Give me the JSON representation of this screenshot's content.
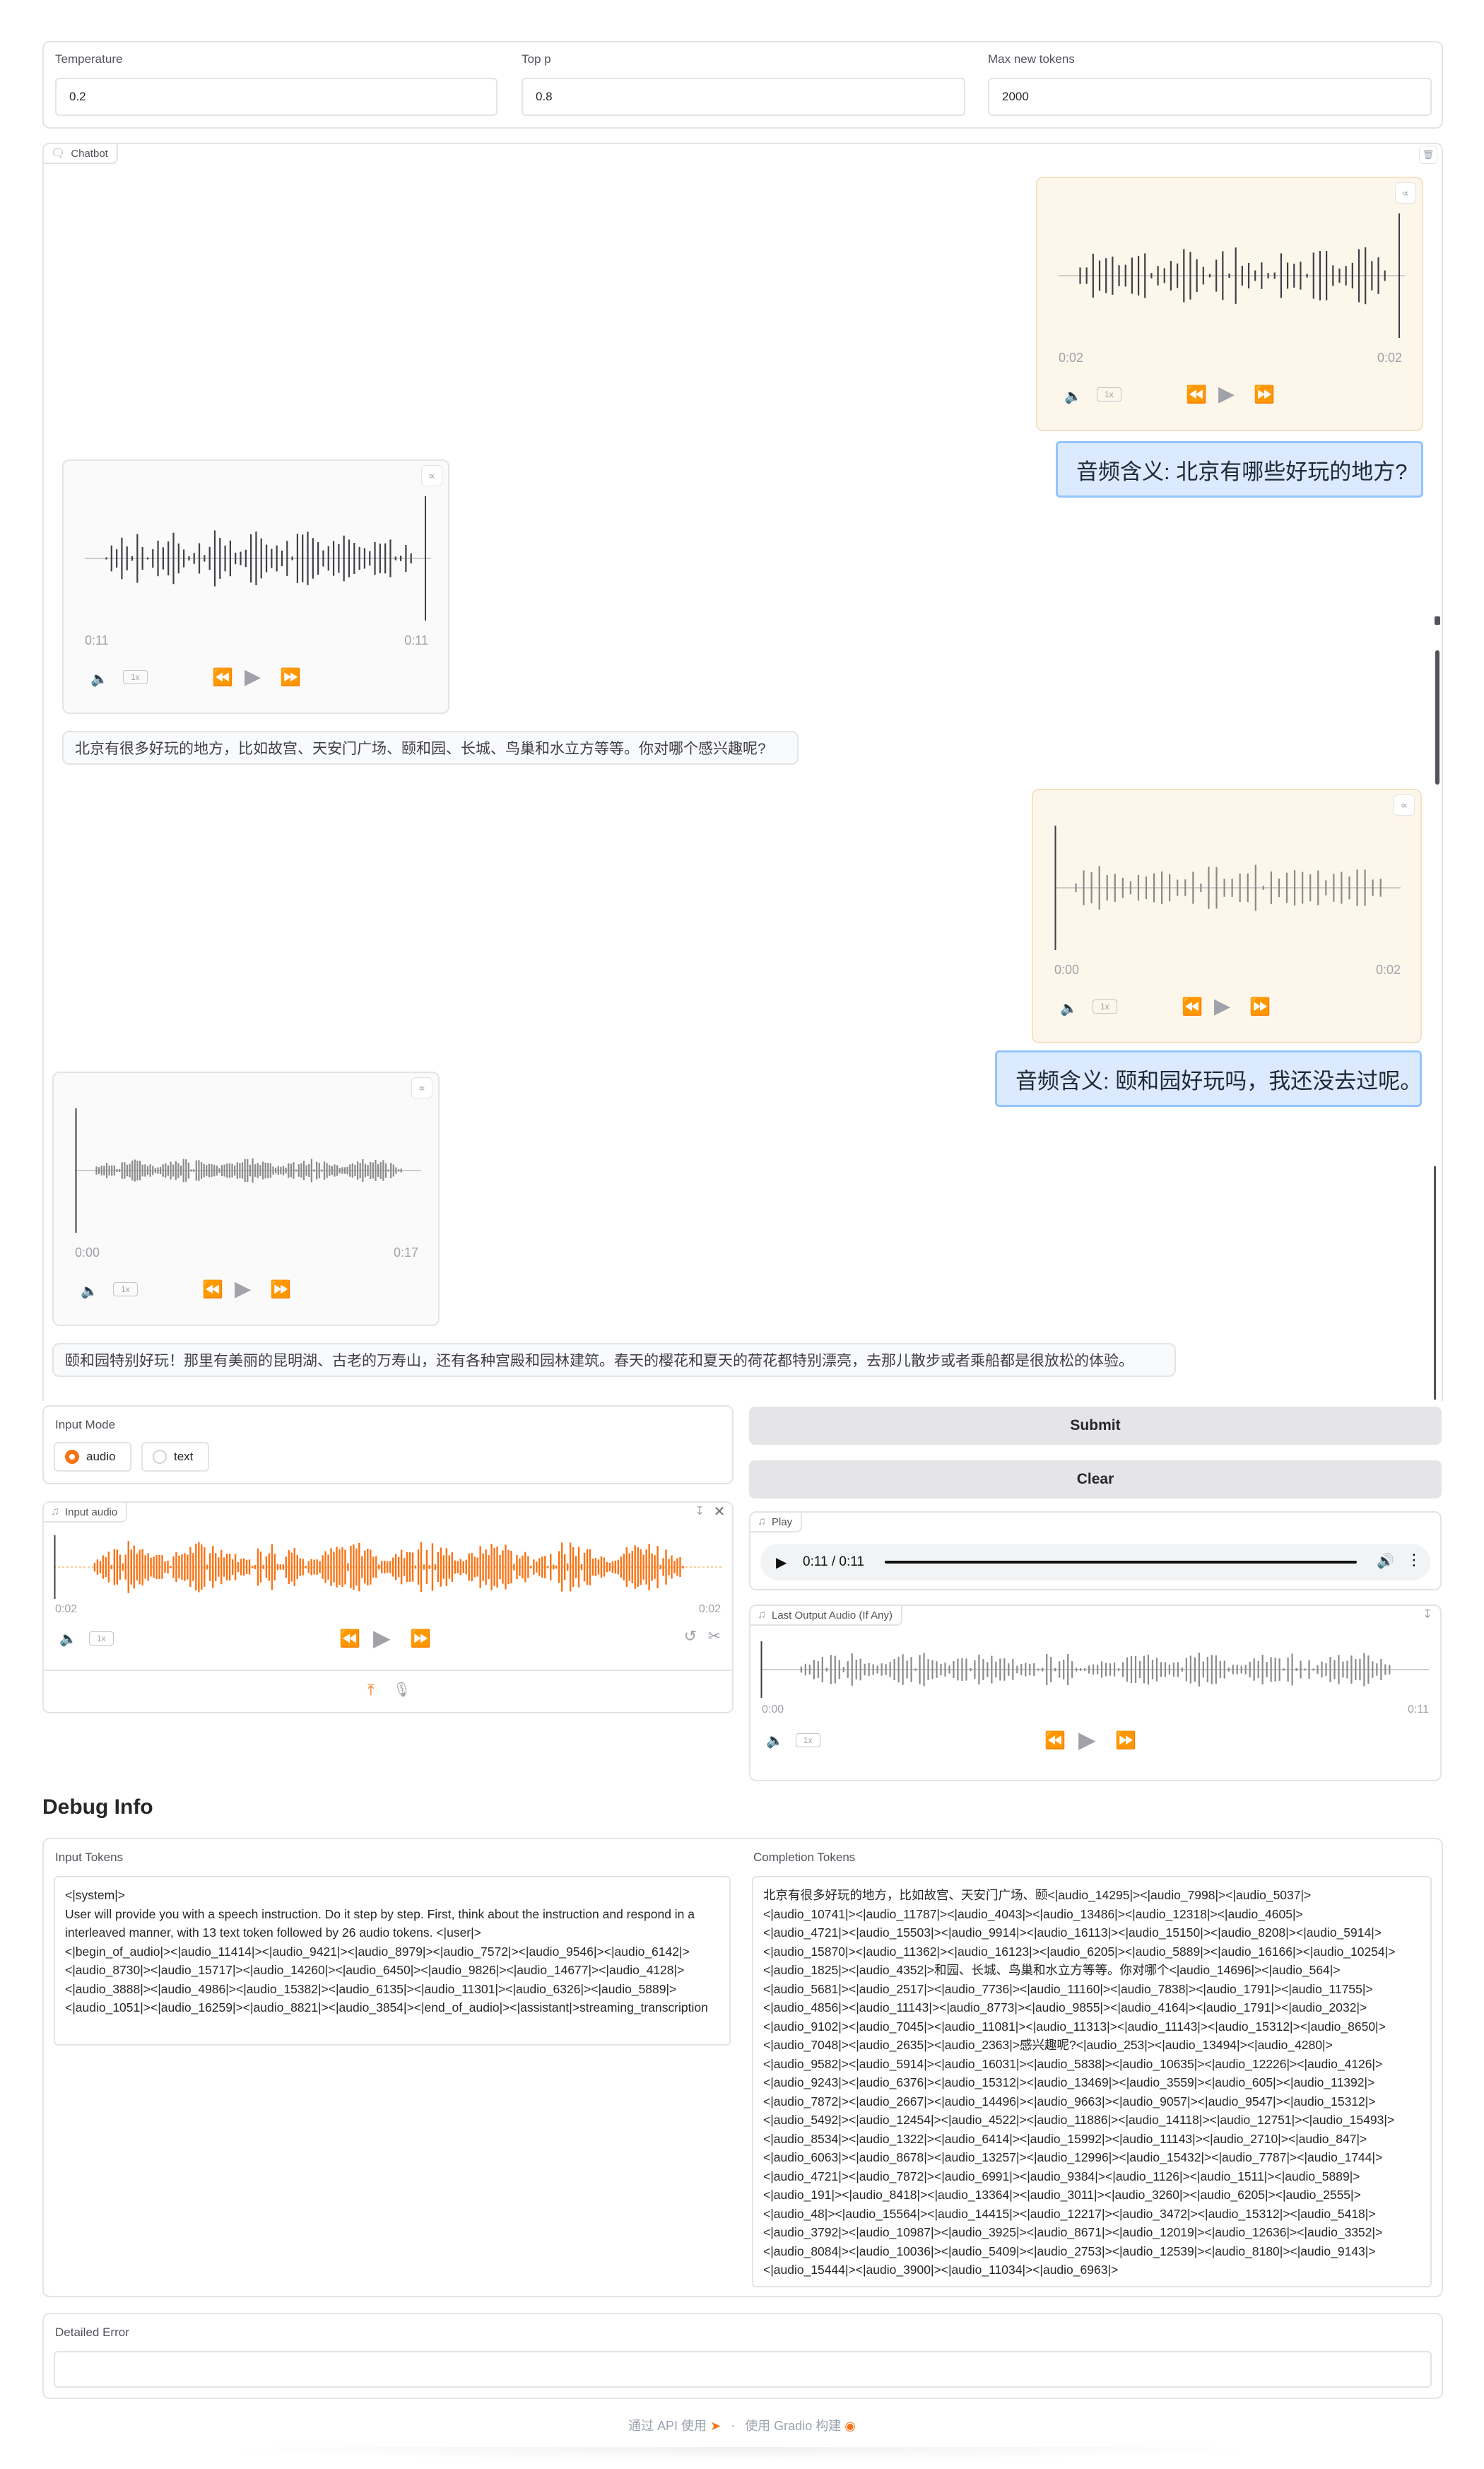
{
  "settings": {
    "temperature": {
      "label": "Temperature",
      "value": "0.2"
    },
    "top_p": {
      "label": "Top p",
      "value": "0.8"
    },
    "max_new_tokens": {
      "label": "Max new tokens",
      "value": "2000"
    }
  },
  "chatbot": {
    "label": "Chatbot",
    "messages": [
      {
        "role": "user",
        "audio": {
          "start": "0:02",
          "end": "0:02",
          "speed": "1x"
        },
        "text": "音频含义: 北京有哪些好玩的地方?"
      },
      {
        "role": "assistant",
        "audio": {
          "start": "0:11",
          "end": "0:11",
          "speed": "1x"
        },
        "text": "北京有很多好玩的地方，比如故宫、天安门广场、颐和园、长城、鸟巢和水立方等等。你对哪个感兴趣呢?"
      },
      {
        "role": "user",
        "audio": {
          "start": "0:00",
          "end": "0:02",
          "speed": "1x"
        },
        "text": "音频含义: 颐和园好玩吗，我还没去过呢。"
      },
      {
        "role": "assistant",
        "audio": {
          "start": "0:00",
          "end": "0:17",
          "speed": "1x"
        },
        "text": "颐和园特别好玩！那里有美丽的昆明湖、古老的万寿山，还有各种宫殿和园林建筑。春天的樱花和夏天的荷花都特别漂亮，去那儿散步或者乘船都是很放松的体验。"
      }
    ]
  },
  "input_mode": {
    "label": "Input Mode",
    "options": [
      "audio",
      "text"
    ],
    "selected": "audio"
  },
  "buttons": {
    "submit": "Submit",
    "clear": "Clear"
  },
  "input_audio": {
    "label": "Input audio",
    "start": "0:02",
    "end": "0:02",
    "speed": "1x"
  },
  "play": {
    "label": "Play",
    "time": "0:11 / 0:11"
  },
  "last_output": {
    "label": "Last Output Audio (If Any)",
    "start": "0:00",
    "end": "0:11",
    "speed": "1x"
  },
  "debug": {
    "title": "Debug Info",
    "input_tokens_label": "Input Tokens",
    "input_tokens": "<|system|>\nUser will provide you with a speech instruction. Do it step by step. First, think about the instruction and respond in a\ninterleaved manner, with 13 text token followed by 26 audio tokens. <|user|>\n<|begin_of_audio|><|audio_11414|><|audio_9421|><|audio_8979|><|audio_7572|><|audio_9546|><|audio_6142|>\n<|audio_8730|><|audio_15717|><|audio_14260|><|audio_6450|><|audio_9826|><|audio_14677|><|audio_4128|>\n<|audio_3888|><|audio_4986|><|audio_15382|><|audio_6135|><|audio_11301|><|audio_6326|><|audio_5889|>\n<|audio_1051|><|audio_16259|><|audio_8821|><|audio_3854|><|end_of_audio|><|assistant|>streaming_transcription",
    "completion_tokens_label": "Completion Tokens",
    "completion_tokens": "北京有很多好玩的地方，比如故宫、天安门广场、颐<|audio_14295|><|audio_7998|><|audio_5037|>\n<|audio_10741|><|audio_11787|><|audio_4043|><|audio_13486|><|audio_12318|><|audio_4605|>\n<|audio_4721|><|audio_15503|><|audio_9914|><|audio_16113|><|audio_15150|><|audio_8208|><|audio_5914|>\n<|audio_15870|><|audio_11362|><|audio_16123|><|audio_6205|><|audio_5889|><|audio_16166|><|audio_10254|>\n<|audio_1825|><|audio_4352|>和园、长城、鸟巢和水立方等等。你对哪个<|audio_14696|><|audio_564|>\n<|audio_5681|><|audio_2517|><|audio_7736|><|audio_11160|><|audio_7838|><|audio_1791|><|audio_11755|>\n<|audio_4856|><|audio_11143|><|audio_8773|><|audio_9855|><|audio_4164|><|audio_1791|><|audio_2032|>\n<|audio_9102|><|audio_7045|><|audio_11081|><|audio_11313|><|audio_11143|><|audio_15312|><|audio_8650|>\n<|audio_7048|><|audio_2635|><|audio_2363|>感兴趣呢?<|audio_253|><|audio_13494|><|audio_4280|>\n<|audio_9582|><|audio_5914|><|audio_16031|><|audio_5838|><|audio_10635|><|audio_12226|><|audio_4126|>\n<|audio_9243|><|audio_6376|><|audio_15312|><|audio_13469|><|audio_3559|><|audio_605|><|audio_11392|>\n<|audio_7872|><|audio_2667|><|audio_14496|><|audio_9663|><|audio_9057|><|audio_9547|><|audio_15312|>\n<|audio_5492|><|audio_12454|><|audio_4522|><|audio_11886|><|audio_14118|><|audio_12751|><|audio_15493|>\n<|audio_8534|><|audio_1322|><|audio_6414|><|audio_15992|><|audio_11143|><|audio_2710|><|audio_847|>\n<|audio_6063|><|audio_8678|><|audio_13257|><|audio_12996|><|audio_15432|><|audio_7787|><|audio_1744|>\n<|audio_4721|><|audio_7872|><|audio_6991|><|audio_9384|><|audio_1126|><|audio_1511|><|audio_5889|>\n<|audio_191|><|audio_8418|><|audio_13364|><|audio_3011|><|audio_3260|><|audio_6205|><|audio_2555|>\n<|audio_48|><|audio_15564|><|audio_14415|><|audio_12217|><|audio_3472|><|audio_15312|><|audio_5418|>\n<|audio_3792|><|audio_10987|><|audio_3925|><|audio_8671|><|audio_12019|><|audio_12636|><|audio_3352|>\n<|audio_8084|><|audio_10036|><|audio_5409|><|audio_2753|><|audio_12539|><|audio_8180|><|audio_9143|>\n<|audio_15444|><|audio_3900|><|audio_11034|><|audio_6963|>",
    "detailed_error_label": "Detailed Error",
    "detailed_error": ""
  },
  "footer": {
    "api": "通过 API 使用",
    "sep": "·",
    "built": "使用 Gradio 构建"
  },
  "colors": {
    "accent": "#f97316",
    "user_bubble": "#dbeafe",
    "user_border": "#93c5fd",
    "user_audio_bg": "#fdf6ea"
  }
}
